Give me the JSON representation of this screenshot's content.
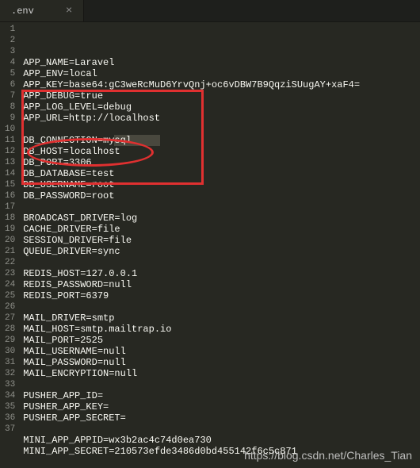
{
  "tab": {
    "title": ".env",
    "close": "×"
  },
  "lines": [
    "APP_NAME=Laravel",
    "APP_ENV=local",
    "APP_KEY=base64:gC3weRcMuD6YrvQnj+oc6vDBW7B9QqziSUugAY+xaF4=",
    "APP_DEBUG=true",
    "APP_LOG_LEVEL=debug",
    "APP_URL=http://localhost",
    "",
    "DB_CONNECTION=mysql",
    "DB_HOST=localhost",
    "DB_PORT=3306",
    "DB_DATABASE=test",
    "DB_USERNAME=root",
    "DB_PASSWORD=root",
    "",
    "BROADCAST_DRIVER=log",
    "CACHE_DRIVER=file",
    "SESSION_DRIVER=file",
    "QUEUE_DRIVER=sync",
    "",
    "REDIS_HOST=127.0.0.1",
    "REDIS_PASSWORD=null",
    "REDIS_PORT=6379",
    "",
    "MAIL_DRIVER=smtp",
    "MAIL_HOST=smtp.mailtrap.io",
    "MAIL_PORT=2525",
    "MAIL_USERNAME=null",
    "MAIL_PASSWORD=null",
    "MAIL_ENCRYPTION=null",
    "",
    "PUSHER_APP_ID=",
    "PUSHER_APP_KEY=",
    "PUSHER_APP_SECRET=",
    "",
    "MINI_APP_APPID=wx3b2ac4c74d0ea730",
    "MINI_APP_SECRET=210573efde3486d0bd455142f6c5c871",
    ""
  ],
  "watermark": "https://blog.csdn.net/Charles_Tian"
}
